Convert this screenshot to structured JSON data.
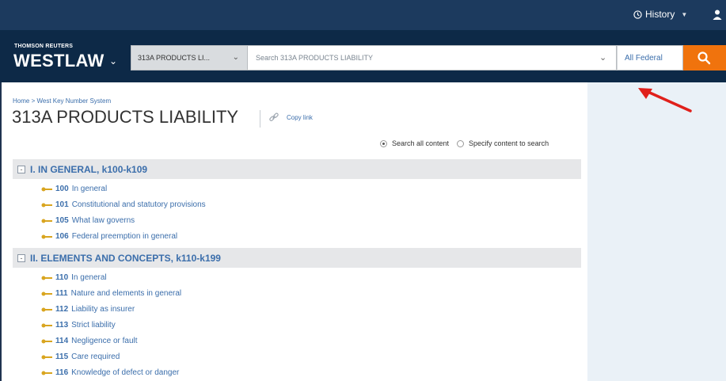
{
  "header": {
    "history_label": "History",
    "brand_small": "THOMSON REUTERS",
    "brand_big": "WESTLAW",
    "scope_value": "313A PRODUCTS LI...",
    "search_placeholder": "Search 313A PRODUCTS LIABILITY",
    "jurisdiction": "All Federal"
  },
  "page": {
    "breadcrumb": "Home > West Key Number System",
    "title": "313A PRODUCTS LIABILITY",
    "copy_link": "Copy link",
    "radio_all": "Search all content",
    "radio_specify": "Specify content to search",
    "radio_selected": "Search all content"
  },
  "sections": [
    {
      "toggle": "-",
      "heading": "I. IN GENERAL, k100-k109",
      "items": [
        {
          "num": "100",
          "text": "In general"
        },
        {
          "num": "101",
          "text": "Constitutional and statutory provisions"
        },
        {
          "num": "105",
          "text": "What law governs"
        },
        {
          "num": "106",
          "text": "Federal preemption in general"
        }
      ]
    },
    {
      "toggle": "-",
      "heading": "II. ELEMENTS AND CONCEPTS, k110-k199",
      "items": [
        {
          "num": "110",
          "text": "In general"
        },
        {
          "num": "111",
          "text": "Nature and elements in general"
        },
        {
          "num": "112",
          "text": "Liability as insurer"
        },
        {
          "num": "113",
          "text": "Strict liability"
        },
        {
          "num": "114",
          "text": "Negligence or fault"
        },
        {
          "num": "115",
          "text": "Care required"
        },
        {
          "num": "116",
          "text": "Knowledge of defect or danger"
        }
      ]
    }
  ],
  "colors": {
    "topbar": "#1c3a5e",
    "navbar": "#0d2947",
    "search_button": "#f0730d",
    "link": "#3b6eab",
    "key_icon": "#d9a520",
    "annotation_arrow": "#e0201b"
  }
}
